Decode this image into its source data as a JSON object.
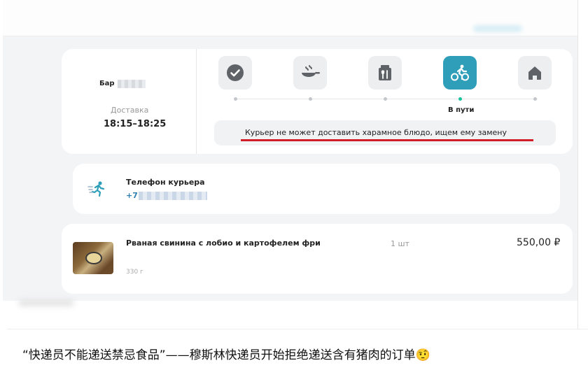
{
  "order": {
    "restaurant_prefix": "Бар",
    "delivery_label": "Доставка",
    "delivery_time": "18:15–18:25",
    "steps": [
      {
        "icon": "check-icon",
        "label": ""
      },
      {
        "icon": "cooking-pan-icon",
        "label": ""
      },
      {
        "icon": "package-icon",
        "label": ""
      },
      {
        "icon": "bicycle-courier-icon",
        "label": "В пути",
        "active": true
      },
      {
        "icon": "home-icon",
        "label": ""
      }
    ],
    "active_step_label": "В пути",
    "status_message": "Курьер не может доставить харамное блюдо, ищем ему замену"
  },
  "courier": {
    "label": "Телефон курьера",
    "phone_prefix": "+7"
  },
  "product": {
    "name": "Рваная свинина с лобио и картофелем фри",
    "quantity": "1 шт",
    "price": "550,00 ₽",
    "weight": "330 г"
  },
  "caption": {
    "text": "“快递员不能递送禁忌食品”——穆斯林快递员开始拒绝递送含有猪肉的订单🤨"
  },
  "colors": {
    "accent": "#2f9fb9",
    "active_dot": "#16c39a",
    "underline": "#d11e28",
    "background": "#f3f4f6"
  }
}
